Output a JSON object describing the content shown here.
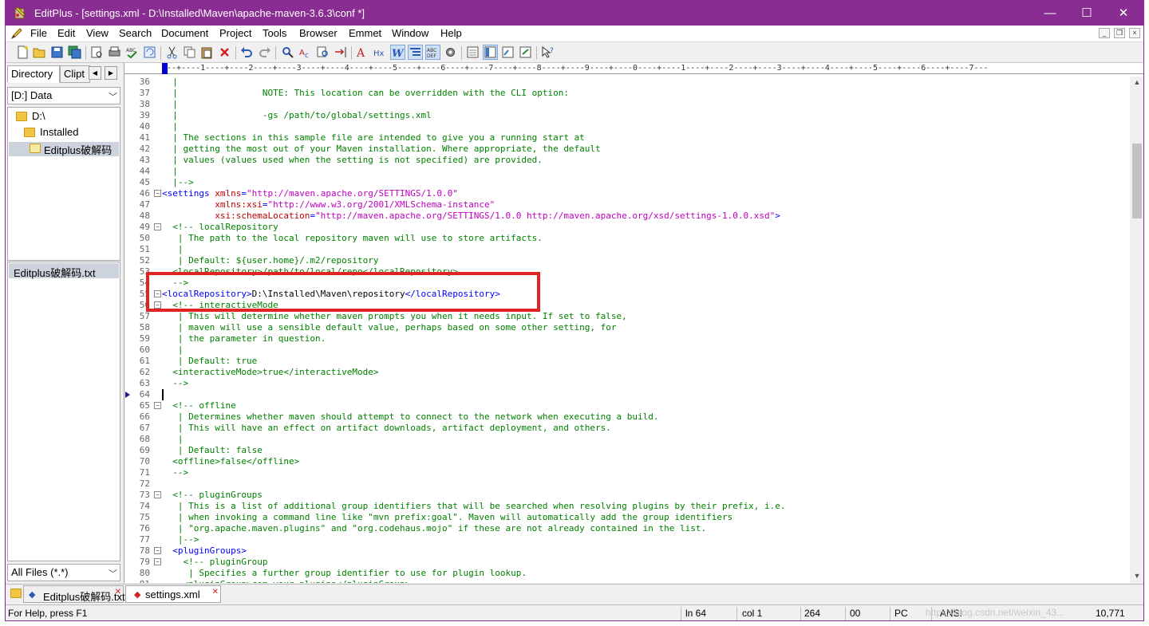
{
  "window": {
    "title": "EditPlus - [settings.xml - D:\\Installed\\Maven\\apache-maven-3.6.3\\conf *]",
    "controls": {
      "minimize": "—",
      "maximize": "☐",
      "close": "✕"
    }
  },
  "menu": {
    "items": [
      "File",
      "Edit",
      "View",
      "Search",
      "Document",
      "Project",
      "Tools",
      "Browser",
      "Emmet",
      "Window",
      "Help"
    ],
    "mdi": {
      "minimize": "_",
      "restore": "❐",
      "close": "×"
    }
  },
  "sidebar": {
    "tabs": [
      "Directory",
      "Clipt"
    ],
    "drive": "[D:] Data",
    "tree": [
      "D:\\",
      "Installed",
      "Editplus破解码"
    ],
    "files": [
      "Editplus破解码.txt"
    ],
    "filter": "All Files (*.*)"
  },
  "editor": {
    "ruler": "---+----1----+----2----+----3----+----4----+----5----+----6----+----7----+----8----+----9----+----0----+----1----+----2----+----3----+----4----+----5----+----6----+----7---",
    "lines": [
      {
        "n": "36",
        "parts": [
          {
            "c": "c",
            "t": "  |"
          }
        ]
      },
      {
        "n": "37",
        "parts": [
          {
            "c": "c",
            "t": "  |                NOTE: This location can be overridden with the CLI option:"
          }
        ]
      },
      {
        "n": "38",
        "parts": [
          {
            "c": "c",
            "t": "  |"
          }
        ]
      },
      {
        "n": "39",
        "parts": [
          {
            "c": "c",
            "t": "  |                -gs /path/to/global/settings.xml"
          }
        ]
      },
      {
        "n": "40",
        "parts": [
          {
            "c": "c",
            "t": "  |"
          }
        ]
      },
      {
        "n": "41",
        "parts": [
          {
            "c": "c",
            "t": "  | The sections in this sample file are intended to give you a running start at"
          }
        ]
      },
      {
        "n": "42",
        "parts": [
          {
            "c": "c",
            "t": "  | getting the most out of your Maven installation. Where appropriate, the default"
          }
        ]
      },
      {
        "n": "43",
        "parts": [
          {
            "c": "c",
            "t": "  | values (values used when the setting is not specified) are provided."
          }
        ]
      },
      {
        "n": "44",
        "parts": [
          {
            "c": "c",
            "t": "  |"
          }
        ]
      },
      {
        "n": "45",
        "parts": [
          {
            "c": "c",
            "t": "  |-->"
          }
        ]
      },
      {
        "n": "46",
        "fold": "−",
        "parts": [
          {
            "c": "t",
            "t": "<settings "
          },
          {
            "c": "a",
            "t": "xmlns"
          },
          {
            "c": "t",
            "t": "="
          },
          {
            "c": "s",
            "t": "\"http://maven.apache.org/SETTINGS/1.0.0\""
          }
        ]
      },
      {
        "n": "47",
        "parts": [
          {
            "c": "a",
            "t": "          xmlns:xsi"
          },
          {
            "c": "t",
            "t": "="
          },
          {
            "c": "s",
            "t": "\"http://www.w3.org/2001/XMLSchema-instance\""
          }
        ]
      },
      {
        "n": "48",
        "parts": [
          {
            "c": "a",
            "t": "          xsi:schemaLocation"
          },
          {
            "c": "t",
            "t": "="
          },
          {
            "c": "s",
            "t": "\"http://maven.apache.org/SETTINGS/1.0.0 http://maven.apache.org/xsd/settings-1.0.0.xsd\""
          },
          {
            "c": "t",
            "t": ">"
          }
        ]
      },
      {
        "n": "49",
        "fold": "−",
        "parts": [
          {
            "c": "c",
            "t": "  <!-- localRepository"
          }
        ]
      },
      {
        "n": "50",
        "parts": [
          {
            "c": "c",
            "t": "   | The path to the local repository maven will use to store artifacts."
          }
        ]
      },
      {
        "n": "51",
        "parts": [
          {
            "c": "c",
            "t": "   |"
          }
        ]
      },
      {
        "n": "52",
        "parts": [
          {
            "c": "c",
            "t": "   | Default: ${user.home}/.m2/repository"
          }
        ]
      },
      {
        "n": "53",
        "parts": [
          {
            "c": "c",
            "t": "  <localRepository>/path/to/local/repo</localRepository>"
          }
        ]
      },
      {
        "n": "54",
        "parts": [
          {
            "c": "c",
            "t": "  -->"
          }
        ]
      },
      {
        "n": "55",
        "fold": "−",
        "parts": [
          {
            "c": "t",
            "t": "<localRepository>"
          },
          {
            "c": "k",
            "t": "D:\\Installed\\Maven\\repository"
          },
          {
            "c": "t",
            "t": "</localRepository>"
          }
        ]
      },
      {
        "n": "56",
        "fold": "−",
        "parts": [
          {
            "c": "c",
            "t": "  <!-- interactiveMode"
          }
        ]
      },
      {
        "n": "57",
        "parts": [
          {
            "c": "c",
            "t": "   | This will determine whether maven prompts you when it needs input. If set to false,"
          }
        ]
      },
      {
        "n": "58",
        "parts": [
          {
            "c": "c",
            "t": "   | maven will use a sensible default value, perhaps based on some other setting, for"
          }
        ]
      },
      {
        "n": "59",
        "parts": [
          {
            "c": "c",
            "t": "   | the parameter in question."
          }
        ]
      },
      {
        "n": "60",
        "parts": [
          {
            "c": "c",
            "t": "   |"
          }
        ]
      },
      {
        "n": "61",
        "parts": [
          {
            "c": "c",
            "t": "   | Default: true"
          }
        ]
      },
      {
        "n": "62",
        "parts": [
          {
            "c": "c",
            "t": "  <interactiveMode>true</interactiveMode>"
          }
        ]
      },
      {
        "n": "63",
        "parts": [
          {
            "c": "c",
            "t": "  -->"
          }
        ]
      },
      {
        "n": "64",
        "parts": [
          {
            "c": "k",
            "t": ""
          }
        ]
      },
      {
        "n": "65",
        "fold": "−",
        "parts": [
          {
            "c": "c",
            "t": "  <!-- offline"
          }
        ]
      },
      {
        "n": "66",
        "parts": [
          {
            "c": "c",
            "t": "   | Determines whether maven should attempt to connect to the network when executing a build."
          }
        ]
      },
      {
        "n": "67",
        "parts": [
          {
            "c": "c",
            "t": "   | This will have an effect on artifact downloads, artifact deployment, and others."
          }
        ]
      },
      {
        "n": "68",
        "parts": [
          {
            "c": "c",
            "t": "   |"
          }
        ]
      },
      {
        "n": "69",
        "parts": [
          {
            "c": "c",
            "t": "   | Default: false"
          }
        ]
      },
      {
        "n": "70",
        "parts": [
          {
            "c": "c",
            "t": "  <offline>false</offline>"
          }
        ]
      },
      {
        "n": "71",
        "parts": [
          {
            "c": "c",
            "t": "  -->"
          }
        ]
      },
      {
        "n": "72",
        "parts": [
          {
            "c": "k",
            "t": ""
          }
        ]
      },
      {
        "n": "73",
        "fold": "−",
        "parts": [
          {
            "c": "c",
            "t": "  <!-- pluginGroups"
          }
        ]
      },
      {
        "n": "74",
        "parts": [
          {
            "c": "c",
            "t": "   | This is a list of additional group identifiers that will be searched when resolving plugins by their prefix, i.e."
          }
        ]
      },
      {
        "n": "75",
        "parts": [
          {
            "c": "c",
            "t": "   | when invoking a command line like \"mvn prefix:goal\". Maven will automatically add the group identifiers"
          }
        ]
      },
      {
        "n": "76",
        "parts": [
          {
            "c": "c",
            "t": "   | \"org.apache.maven.plugins\" and \"org.codehaus.mojo\" if these are not already contained in the list."
          }
        ]
      },
      {
        "n": "77",
        "parts": [
          {
            "c": "c",
            "t": "   |-->"
          }
        ]
      },
      {
        "n": "78",
        "fold": "−",
        "parts": [
          {
            "c": "t",
            "t": "  <pluginGroups>"
          }
        ]
      },
      {
        "n": "79",
        "fold": "−",
        "parts": [
          {
            "c": "c",
            "t": "    <!-- pluginGroup"
          }
        ]
      },
      {
        "n": "80",
        "parts": [
          {
            "c": "c",
            "t": "     | Specifies a further group identifier to use for plugin lookup."
          }
        ]
      },
      {
        "n": "81",
        "parts": [
          {
            "c": "c",
            "t": "    <pluginGroup>com.your.plugins</pluginGroup>"
          }
        ]
      }
    ]
  },
  "tabs": [
    {
      "label": "Editplus破解码.txt"
    },
    {
      "label": "settings.xml"
    }
  ],
  "status": {
    "help": "For Help, press F1",
    "line": "ln 64",
    "col": "col 1",
    "c264": "264",
    "c00": "00",
    "pc": "PC",
    "enc": "ANSI",
    "size": "10,771"
  },
  "watermark": "https://blog.csdn.net/weixin_43..."
}
